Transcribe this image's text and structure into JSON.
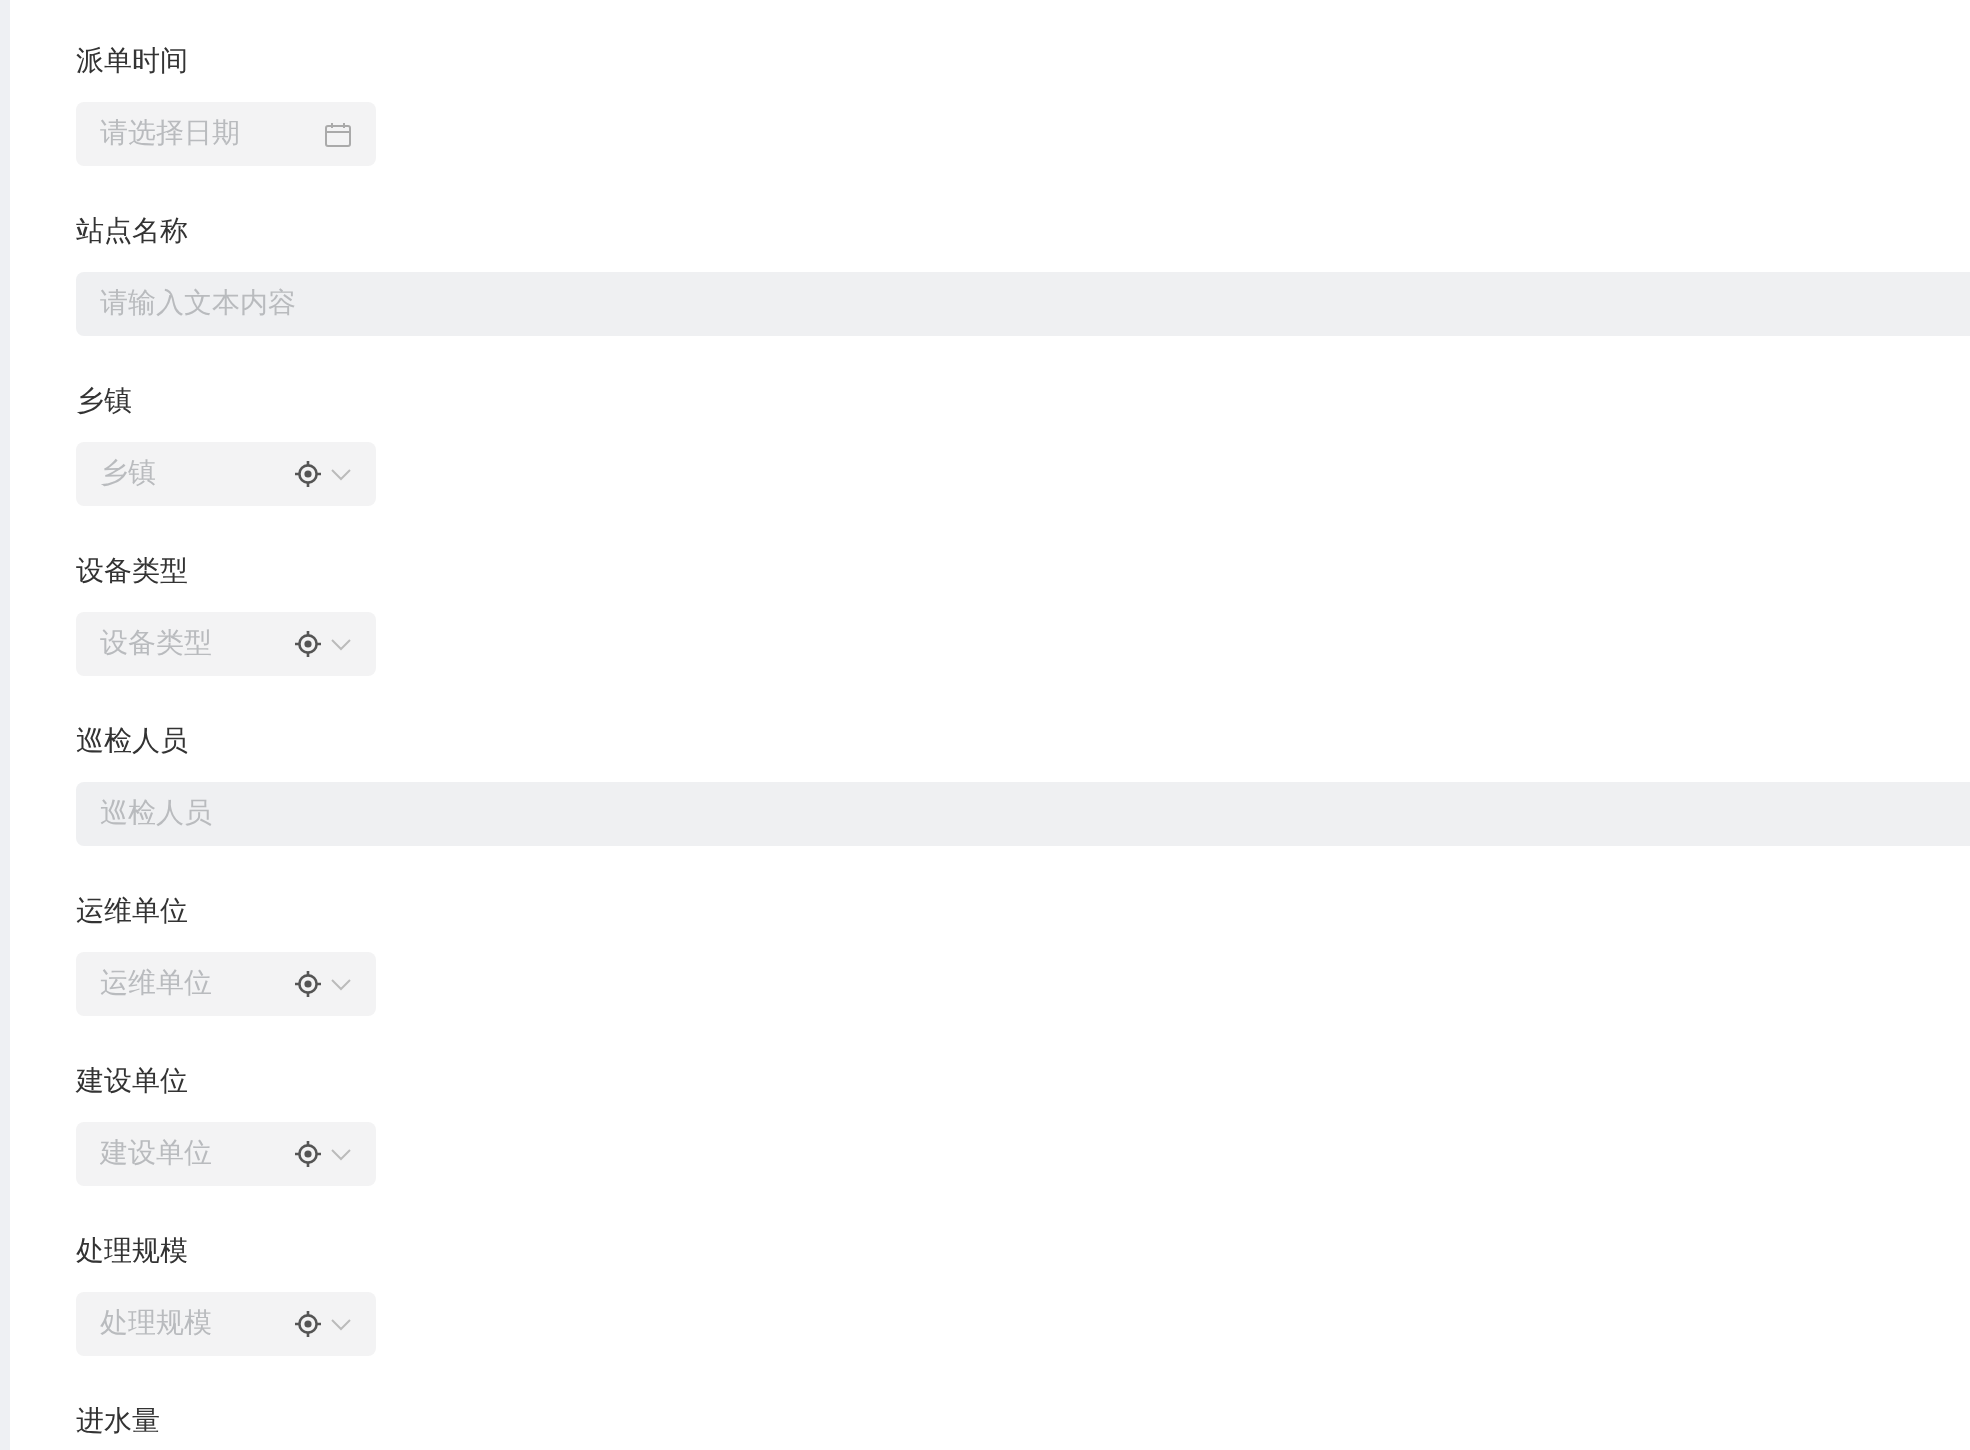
{
  "fields": [
    {
      "label": "派单时间",
      "kind": "date",
      "placeholder": "请选择日期"
    },
    {
      "label": "站点名称",
      "kind": "text",
      "placeholder": "请输入文本内容"
    },
    {
      "label": "乡镇",
      "kind": "select",
      "placeholder": "乡镇"
    },
    {
      "label": "设备类型",
      "kind": "select",
      "placeholder": "设备类型"
    },
    {
      "label": "巡检人员",
      "kind": "text",
      "placeholder": "巡检人员"
    },
    {
      "label": "运维单位",
      "kind": "select",
      "placeholder": "运维单位"
    },
    {
      "label": "建设单位",
      "kind": "select",
      "placeholder": "建设单位"
    },
    {
      "label": "处理规模",
      "kind": "select",
      "placeholder": "处理规模"
    },
    {
      "label": "进水量",
      "kind": "label-only"
    }
  ]
}
